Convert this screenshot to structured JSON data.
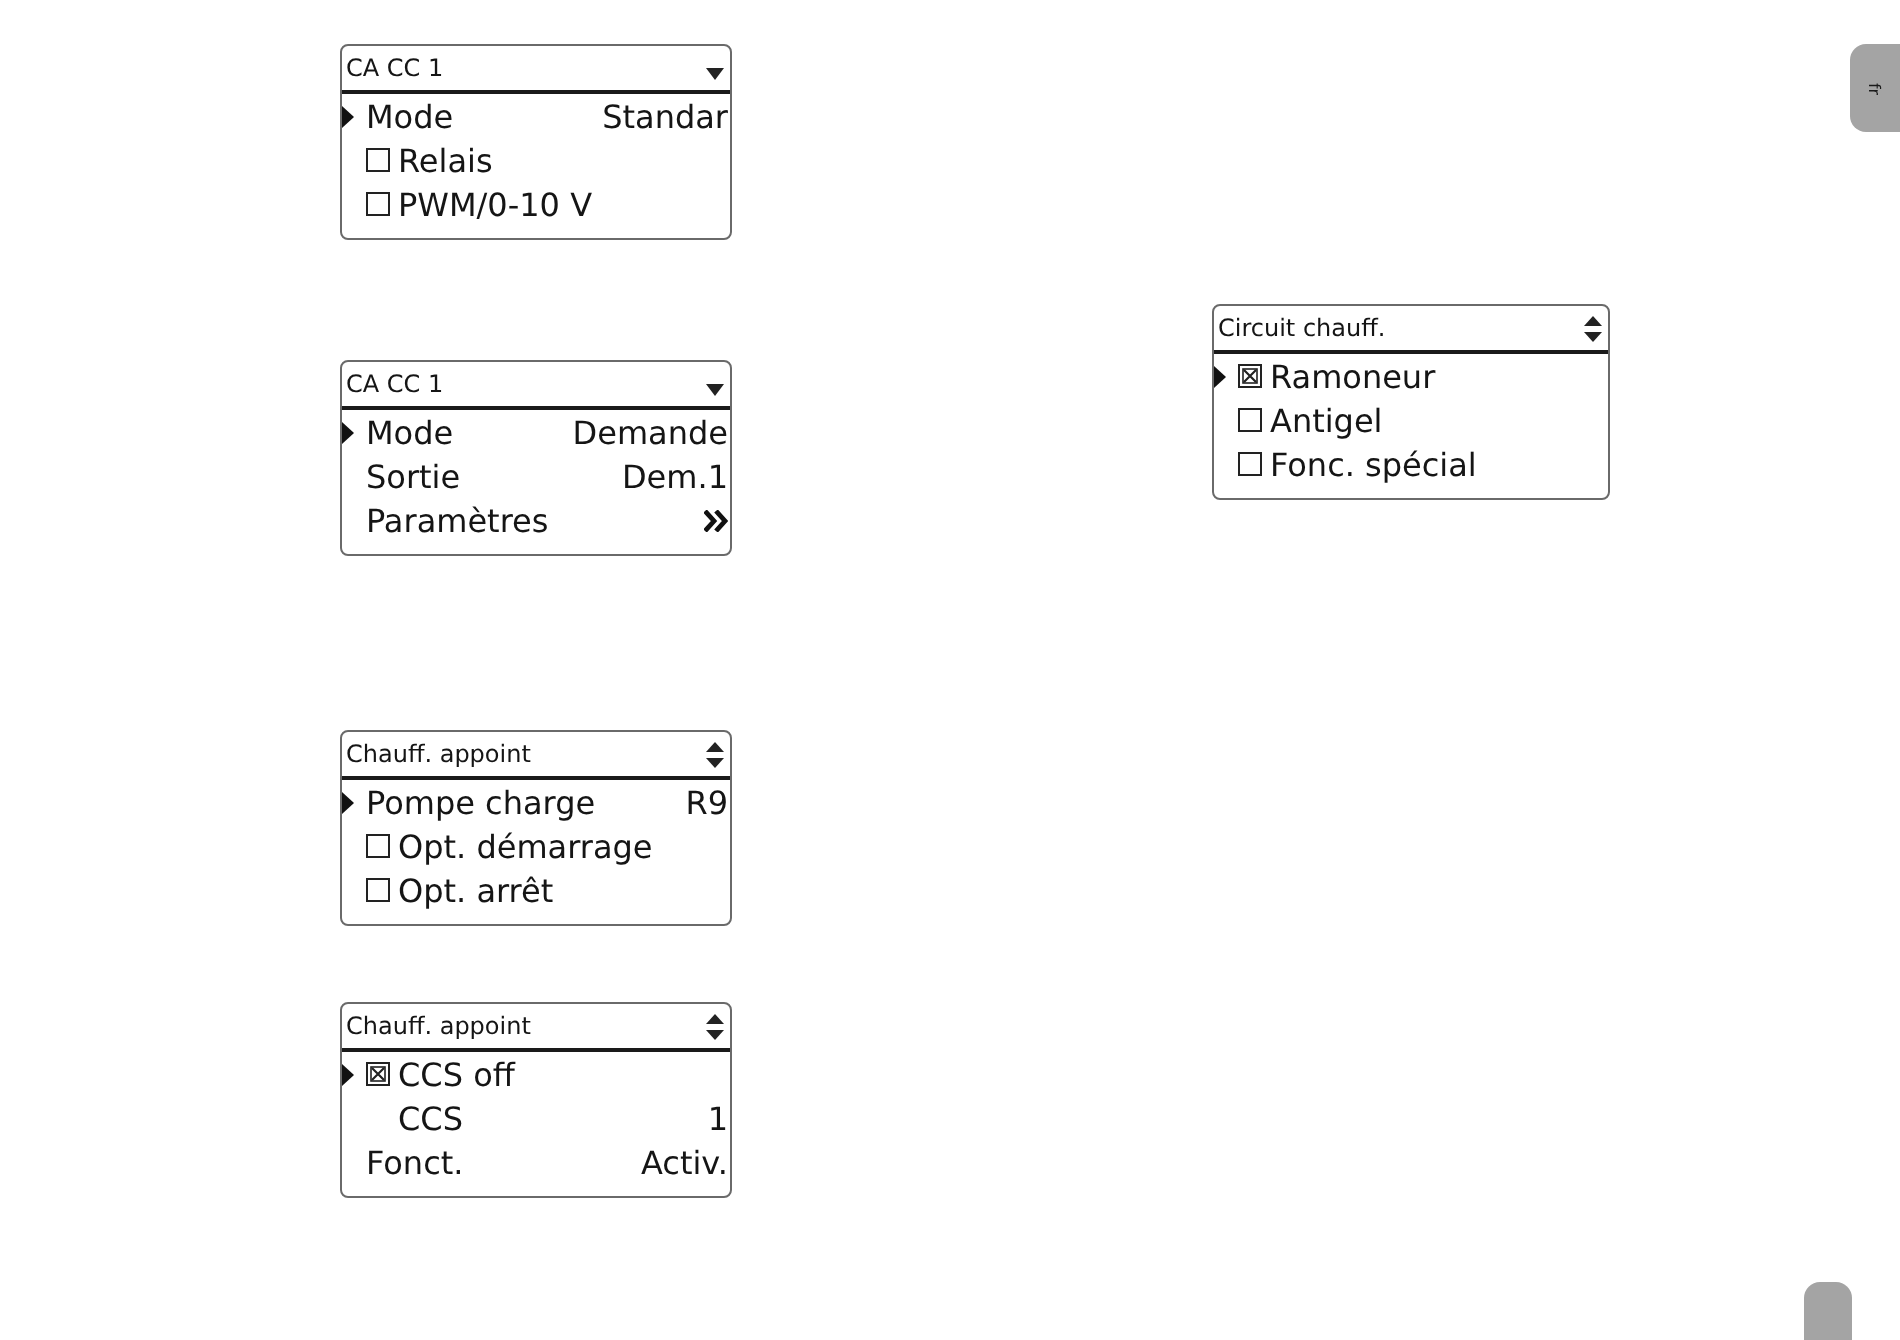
{
  "columns": [
    {
      "displays": [
        {
          "title": "CA CC 1",
          "scroll_up": false,
          "scroll_down": true,
          "rows": [
            {
              "kind": "value",
              "label": "Mode",
              "value": "Standar",
              "selected": true
            },
            {
              "kind": "checkbox",
              "label": "Relais",
              "checked": false,
              "selected": false
            },
            {
              "kind": "checkbox",
              "label": "PWM/0-10 V",
              "checked": false,
              "selected": false
            }
          ]
        },
        {
          "title": "CA CC 1",
          "scroll_up": false,
          "scroll_down": true,
          "rows": [
            {
              "kind": "value",
              "label": "Mode",
              "value": "Demande",
              "selected": true
            },
            {
              "kind": "value",
              "label": "Sortie",
              "value": "Dem.1",
              "selected": false
            },
            {
              "kind": "submenu",
              "label": "Paramètres",
              "selected": false
            }
          ]
        },
        {
          "title": "Chauff. appoint",
          "scroll_up": true,
          "scroll_down": true,
          "rows": [
            {
              "kind": "value",
              "label": "Pompe charge",
              "value": "R9",
              "selected": true
            },
            {
              "kind": "checkbox",
              "label": "Opt. démarrage",
              "checked": false,
              "selected": false
            },
            {
              "kind": "checkbox",
              "label": "Opt. arrêt",
              "checked": false,
              "selected": false
            }
          ]
        },
        {
          "title": "Chauff. appoint",
          "scroll_up": true,
          "scroll_down": true,
          "rows": [
            {
              "kind": "checkbox",
              "label": "CCS off",
              "checked": true,
              "selected": true,
              "children": [
                {
                  "kind": "value",
                  "label": "CCS",
                  "value": "1",
                  "selected": false
                }
              ]
            },
            {
              "kind": "value",
              "label": "Fonct.",
              "value": "Activ.",
              "selected": false
            }
          ]
        }
      ]
    },
    {
      "displays": [
        {
          "title": "Circuit chauff.",
          "scroll_up": true,
          "scroll_down": true,
          "rows": [
            {
              "kind": "checkbox",
              "label": "Ramoneur",
              "checked": true,
              "selected": true
            },
            {
              "kind": "checkbox",
              "label": "Antigel",
              "checked": false,
              "selected": false
            },
            {
              "kind": "checkbox",
              "label": "Fonc. spécial",
              "checked": false,
              "selected": false
            }
          ]
        }
      ]
    }
  ],
  "language_tab": {
    "label": "fr"
  }
}
